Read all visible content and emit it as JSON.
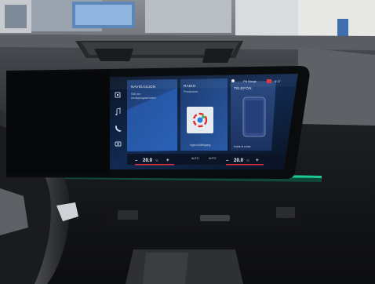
{
  "screen": {
    "status_bar": {
      "signal": "Pä Norge",
      "time": "1:17"
    },
    "tiles": [
      {
        "title": "NAVIGASJON",
        "subtitle": "Slå ner\nnedsprogrammert"
      },
      {
        "title": "RADIO",
        "subtitle": "Prosedure",
        "caption": "Ingen kildetilgang"
      },
      {
        "title": "TELEFON",
        "subtitle": "",
        "caption": "Koble til enhet"
      }
    ],
    "climate": {
      "left_temp": "20.0",
      "left_unit": "°C",
      "right_temp": "20.0",
      "right_unit": "°C",
      "minus": "–",
      "plus": "+"
    },
    "center_labels": [
      "AUTO",
      "AUTO"
    ]
  },
  "colors": {
    "screen_bg": "#0b1a33",
    "tile_accent": "#3a7bd5",
    "ambient_light": "#19e0a0",
    "climate_red": "#e0303c"
  },
  "icons": [
    "home-icon",
    "music-icon",
    "phone-icon",
    "camera-icon"
  ]
}
